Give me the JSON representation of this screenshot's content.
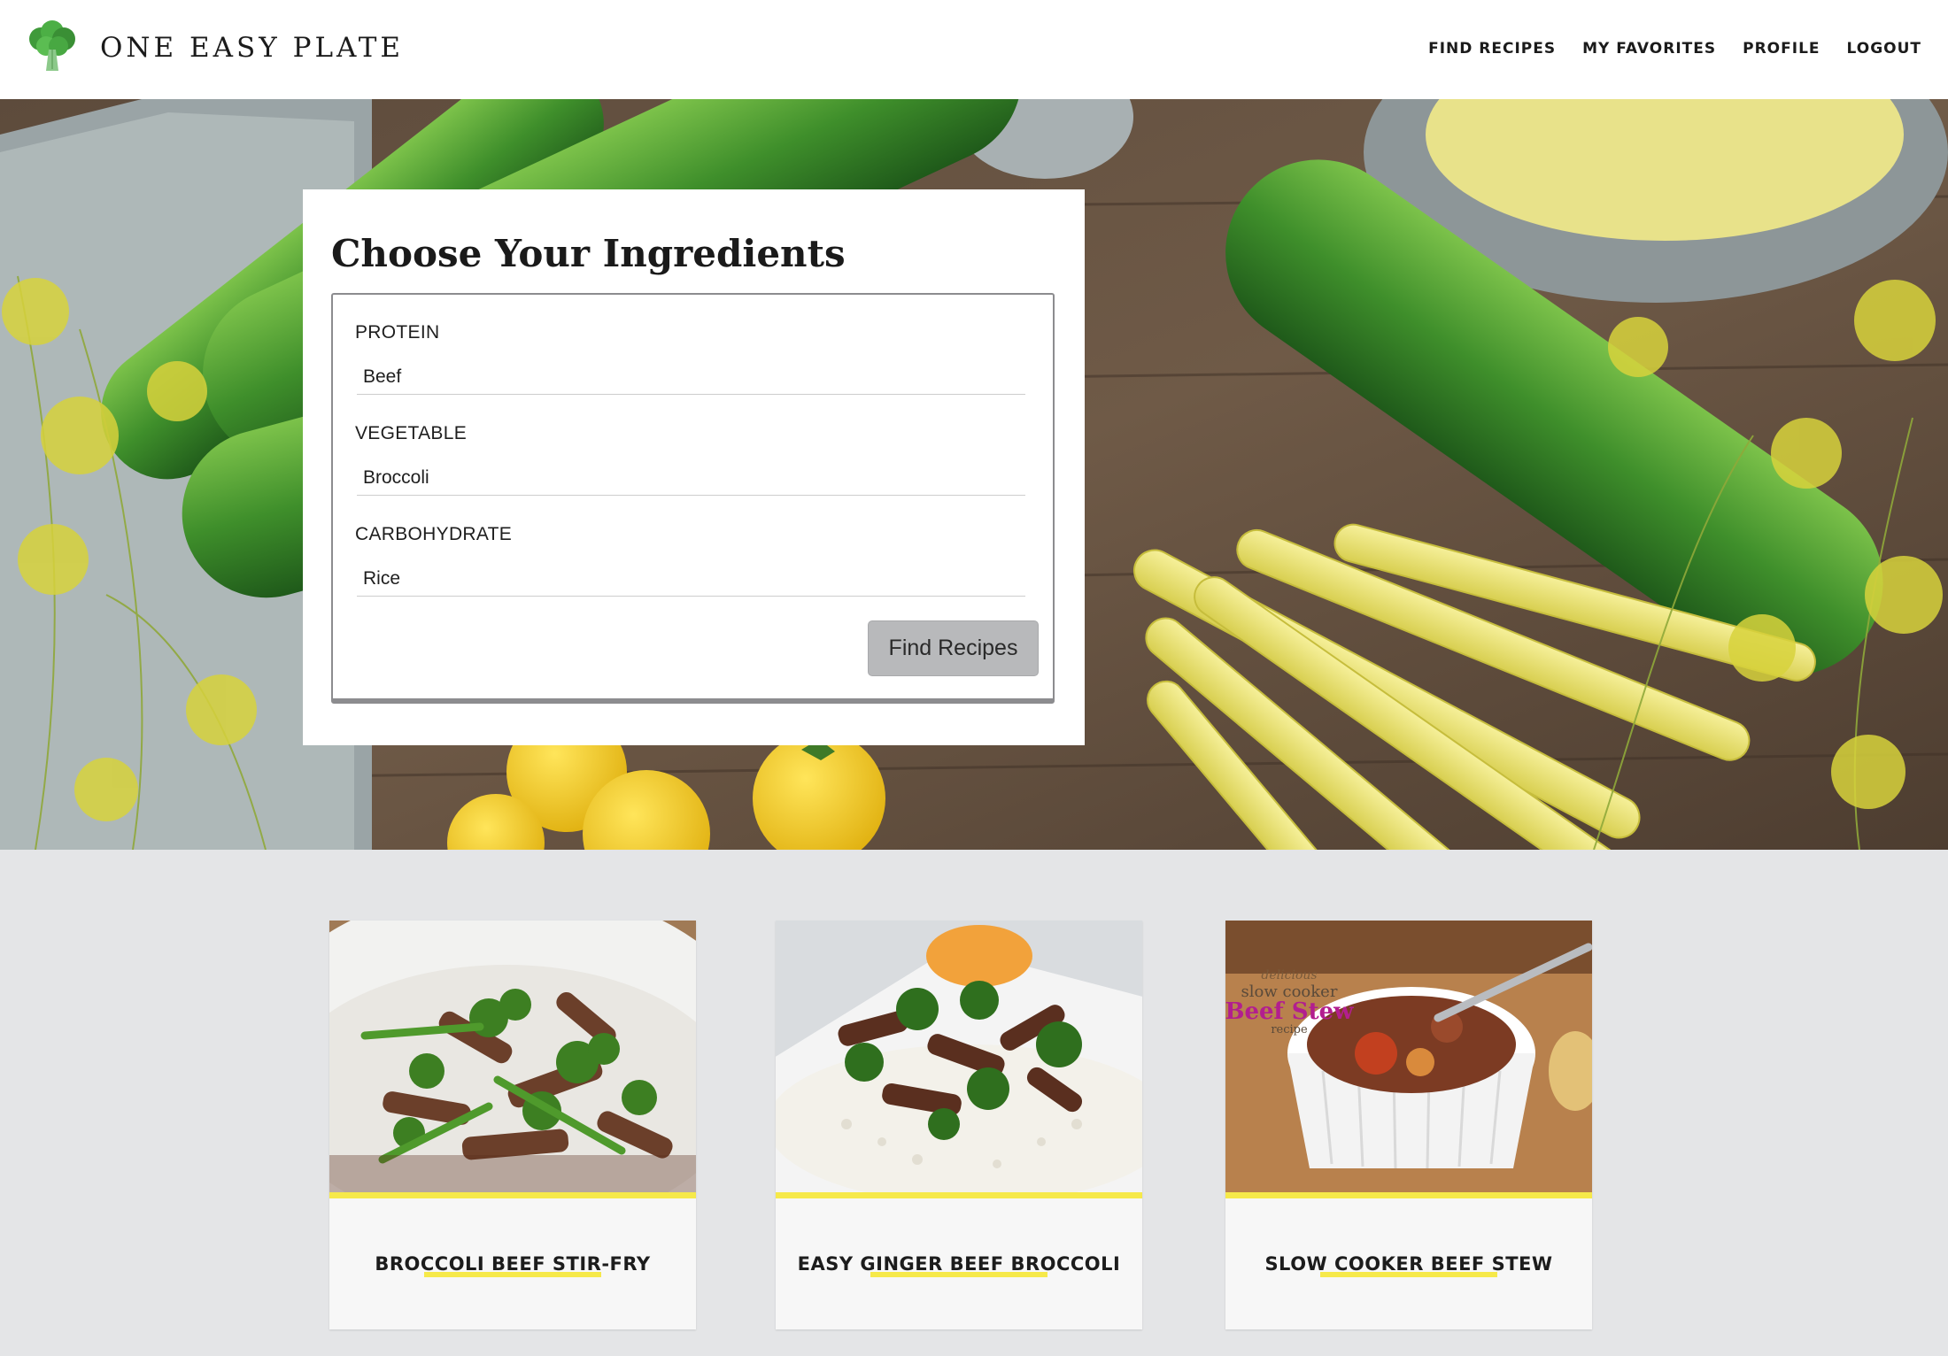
{
  "header": {
    "brand": "ONE EASY PLATE",
    "logo_icon": "broccoli-icon",
    "nav": [
      {
        "label": "FIND RECIPES"
      },
      {
        "label": "MY FAVORITES"
      },
      {
        "label": "PROFILE"
      },
      {
        "label": "LOGOUT"
      }
    ]
  },
  "form": {
    "title": "Choose Your Ingredients",
    "fields": [
      {
        "label": "PROTEIN",
        "value": "Beef"
      },
      {
        "label": "VEGETABLE",
        "value": "Broccoli"
      },
      {
        "label": "CARBOHYDRATE",
        "value": "Rice"
      }
    ],
    "submit_label": "Find Recipes"
  },
  "recipes": [
    {
      "title": "BROCCOLI BEEF STIR-FRY",
      "image": "beef-broccoli-stir-fry-photo"
    },
    {
      "title": "EASY GINGER BEEF BROCCOLI",
      "image": "ginger-beef-broccoli-rice-photo"
    },
    {
      "title": "SLOW COOKER BEEF STEW",
      "image": "slow-cooker-beef-stew-photo",
      "image_text": [
        "delicious",
        "slow cooker",
        "Beef Stew",
        "recipe"
      ]
    }
  ],
  "colors": {
    "accent_yellow": "#f6e94a",
    "button_gray": "#b8b9bb",
    "page_bg": "#e4e5e7"
  }
}
